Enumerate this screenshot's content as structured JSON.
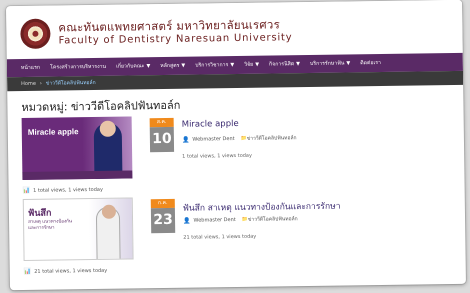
{
  "header": {
    "title_th": "คณะทันตแพทยศาสตร์ มหาวิทยาลัยนเรศวร",
    "title_en": "Faculty of Dentistry Naresuan University"
  },
  "nav": {
    "items": [
      {
        "label": "หน้าแรก",
        "dropdown": false
      },
      {
        "label": "โครงสร้างการบริหารงาน",
        "dropdown": false
      },
      {
        "label": "เกี่ยวกับคณะ",
        "dropdown": true
      },
      {
        "label": "หลักสูตร",
        "dropdown": true
      },
      {
        "label": "บริการวิชาการ",
        "dropdown": true
      },
      {
        "label": "วิจัย",
        "dropdown": true
      },
      {
        "label": "กิจการนิสิต",
        "dropdown": true
      },
      {
        "label": "บริการรักษาฟัน",
        "dropdown": true
      },
      {
        "label": "ติดต่อเรา",
        "dropdown": false
      }
    ]
  },
  "breadcrumb": {
    "home": "Home",
    "current": "ข่าววีดีโอคลิปฟันทอล์ก"
  },
  "page": {
    "title": "หมวดหมู่: ข่าววีดีโอคลิปฟันทอล์ก"
  },
  "posts": [
    {
      "month": "ส.ค.",
      "day": "10",
      "title": "Miracle apple",
      "author": "Webmaster Dent",
      "category": "ข่าววีดีโอคลิปฟันทอล์ก",
      "views": "1 total views, 1 views today",
      "thumb_text": "Miracle apple",
      "stats": "1 total views, 1 views today"
    },
    {
      "month": "ก.ค.",
      "day": "23",
      "title": "ฟันสึก สาเหตุ แนวทางป้องกันและการรักษา",
      "author": "Webmaster Dent",
      "category": "ข่าววีดีโอคลิปฟันทอล์ก",
      "views": "21 total views, 1 views today",
      "thumb_text": "ฟันสึก",
      "thumb_sub": "สาเหตุ แนวทางป้องกัน และการรักษา",
      "stats": "21 total views, 1 views today"
    }
  ],
  "icons": {
    "caret": "▼",
    "crumb_sep": "›",
    "user": "👤",
    "folder": "📁",
    "chart": "📊"
  },
  "colors": {
    "nav_bg": "#5a2a66",
    "crumb_bg": "#3a3a3a",
    "brand": "#6b1f1f",
    "date_month": "#f08a1c",
    "date_day": "#8a8a8a"
  }
}
